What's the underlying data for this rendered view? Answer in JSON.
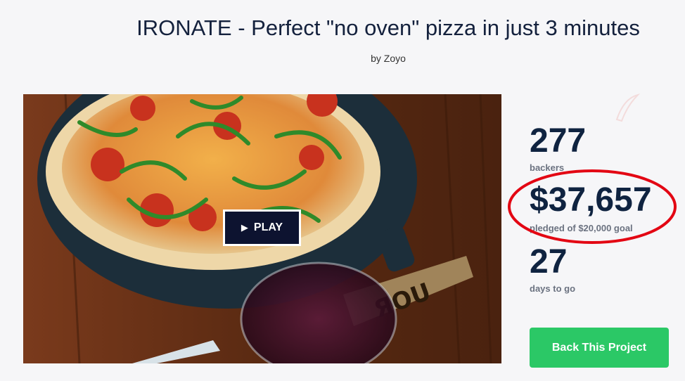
{
  "project": {
    "title": "IRONATE - Perfect \"no oven\" pizza in just 3 minutes",
    "byline": "by Zoyo"
  },
  "media": {
    "play_label": "PLAY",
    "play_icon": "play-triangle-icon"
  },
  "stats": {
    "backers_count": "277",
    "backers_label": "backers",
    "pledged_amount": "$37,657",
    "pledged_label": "pledged of $20,000 goal",
    "days_count": "27",
    "days_label": "days to go"
  },
  "actions": {
    "back_label": "Back This Project"
  },
  "colors": {
    "background": "#f6f6f8",
    "title": "#14213d",
    "stat_number": "#0f2340",
    "stat_label": "#6b7280",
    "back_button": "#2bc866",
    "play_button": "#0d1330",
    "highlight": "#e30613"
  }
}
